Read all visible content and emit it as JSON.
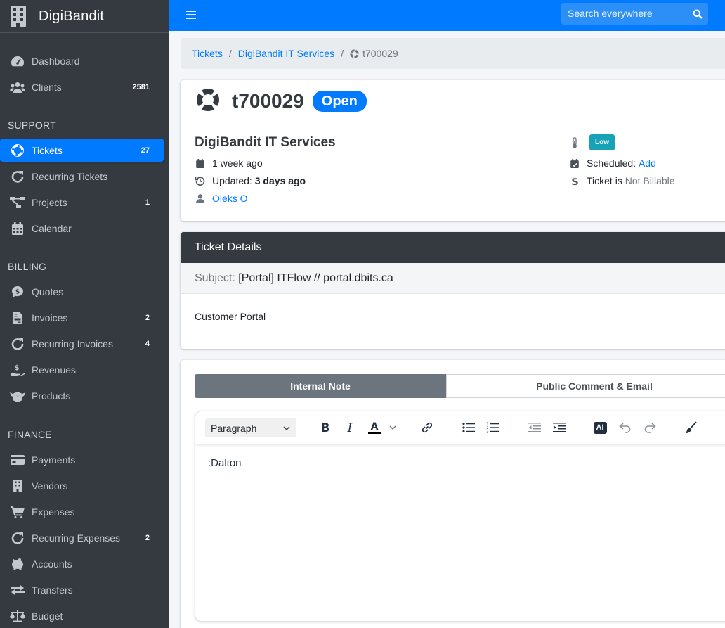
{
  "brand": {
    "name": "DigiBandit"
  },
  "sidebar": {
    "items": [
      {
        "label": "Dashboard",
        "count": ""
      },
      {
        "label": "Clients",
        "count": "2581"
      }
    ],
    "sections": [
      {
        "header": "SUPPORT",
        "items": [
          {
            "label": "Tickets",
            "count": "27"
          },
          {
            "label": "Recurring Tickets",
            "count": ""
          },
          {
            "label": "Projects",
            "count": "1"
          },
          {
            "label": "Calendar",
            "count": ""
          }
        ]
      },
      {
        "header": "BILLING",
        "items": [
          {
            "label": "Quotes",
            "count": ""
          },
          {
            "label": "Invoices",
            "count": "2"
          },
          {
            "label": "Recurring Invoices",
            "count": "4"
          },
          {
            "label": "Revenues",
            "count": ""
          },
          {
            "label": "Products",
            "count": ""
          }
        ]
      },
      {
        "header": "FINANCE",
        "items": [
          {
            "label": "Payments",
            "count": ""
          },
          {
            "label": "Vendors",
            "count": ""
          },
          {
            "label": "Expenses",
            "count": ""
          },
          {
            "label": "Recurring Expenses",
            "count": "2"
          },
          {
            "label": "Accounts",
            "count": ""
          },
          {
            "label": "Transfers",
            "count": ""
          },
          {
            "label": "Budget",
            "count": ""
          }
        ]
      }
    ],
    "active": "Tickets"
  },
  "topbar": {
    "search_placeholder": "Search everywhere"
  },
  "breadcrumb": {
    "items": [
      "Tickets",
      "DigiBandit IT Services"
    ],
    "current": "t700029"
  },
  "ticket": {
    "number": "t700029",
    "status": "Open",
    "client": "DigiBandit IT Services",
    "created": "1 week ago",
    "updated_label": "Updated:",
    "updated_value": "3 days ago",
    "assignee": "Oleks O",
    "priority": "Low",
    "scheduled_label": "Scheduled:",
    "scheduled_action": "Add",
    "billable_prefix": "Ticket is",
    "billable_value": "Not Billable"
  },
  "details": {
    "header": "Ticket Details",
    "subject_label": "Subject:",
    "subject_value": "[Portal] ITFlow // portal.dbits.ca",
    "body": "Customer Portal"
  },
  "reply": {
    "tabs": [
      "Internal Note",
      "Public Comment & Email"
    ],
    "editor": {
      "block_format": "Paragraph",
      "ai_label": "AI",
      "content": ":Dalton"
    }
  },
  "colors": {
    "primary": "#007bff",
    "sidebar": "#343a40",
    "info": "#17a2b8"
  }
}
